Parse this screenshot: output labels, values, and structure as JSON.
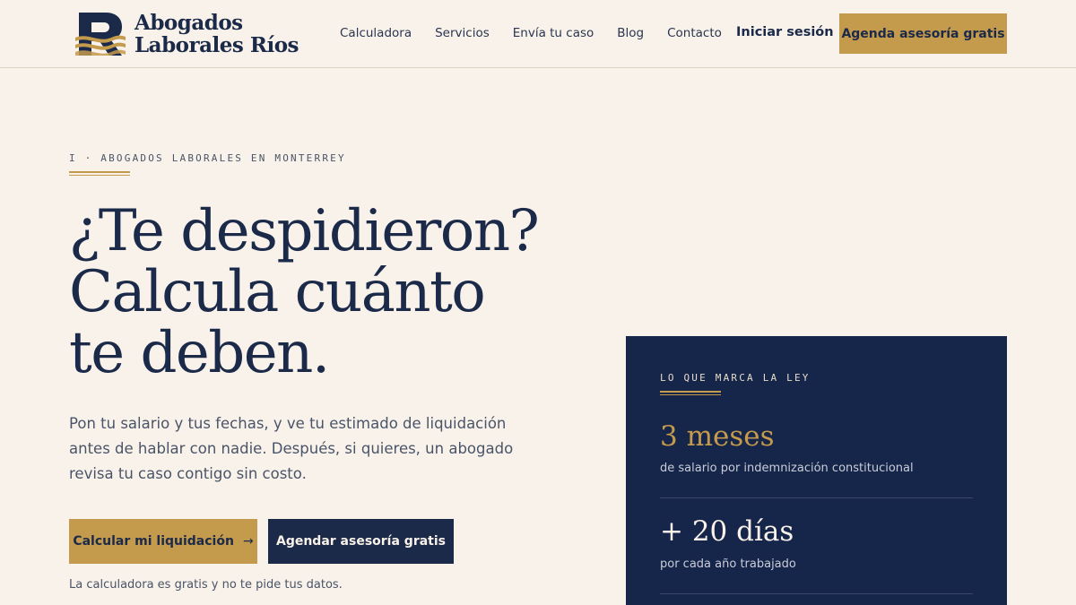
{
  "brand": {
    "name_line1": "Abogados",
    "name_line2": "Laborales Ríos",
    "colors": {
      "navy": "#1c2a49",
      "gold": "#c49a4c",
      "cream": "#f8f2ea"
    }
  },
  "nav": {
    "items": [
      "Calculadora",
      "Servicios",
      "Envía tu caso",
      "Blog",
      "Contacto"
    ],
    "login_label": "Iniciar sesión",
    "cta_label": "Agenda asesoría gratis"
  },
  "hero": {
    "eyebrow": "I · ABOGADOS LABORALES EN MONTERREY",
    "headline_lines": [
      "¿Te despidieron?",
      "Calcula cuánto",
      "te deben."
    ],
    "lead": "Pon tu salario y tus fechas, y ve tu estimado de liquidación antes de hablar con nadie. Después, si quieres, un abogado revisa tu caso contigo sin costo.",
    "primary_label": "Calcular mi liquidación",
    "primary_icon": "arrow-right-icon",
    "secondary_label": "Agendar asesoría gratis",
    "note": "La calculadora es gratis y no te pide tus datos."
  },
  "law_card": {
    "eyebrow": "LO QUE MARCA LA LEY",
    "stats": [
      {
        "value": "3 meses",
        "label": "de salario por indemnización constitucional"
      },
      {
        "value": "+ 20 días",
        "label": "por cada año trabajado"
      }
    ]
  }
}
